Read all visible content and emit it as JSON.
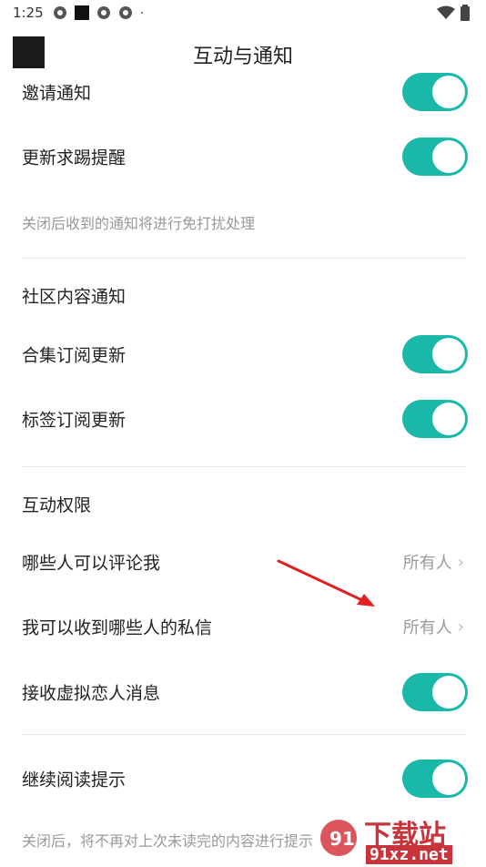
{
  "status_bar": {
    "time": "1:25"
  },
  "header": {
    "title": "互动与通知"
  },
  "notifications": {
    "invite_label": "邀请通知",
    "update_request_label": "更新求踢提醒",
    "hint": "关闭后收到的通知将进行免打扰处理"
  },
  "community": {
    "title": "社区内容通知",
    "collection_label": "合集订阅更新",
    "tag_label": "标签订阅更新"
  },
  "permissions": {
    "title": "互动权限",
    "comment_label": "哪些人可以评论我",
    "comment_value": "所有人",
    "dm_label": "我可以收到哪些人的私信",
    "dm_value": "所有人",
    "virtual_lover_label": "接收虚拟恋人消息"
  },
  "reading": {
    "continue_label": "继续阅读提示",
    "hint": "关闭后，将不再对上次未读完的内容进行提示"
  },
  "watermark": {
    "text": "下载站",
    "url_text": "91xz.net"
  },
  "colors": {
    "toggle_on": "#1ab8a8",
    "annotation_arrow": "#e02020"
  }
}
